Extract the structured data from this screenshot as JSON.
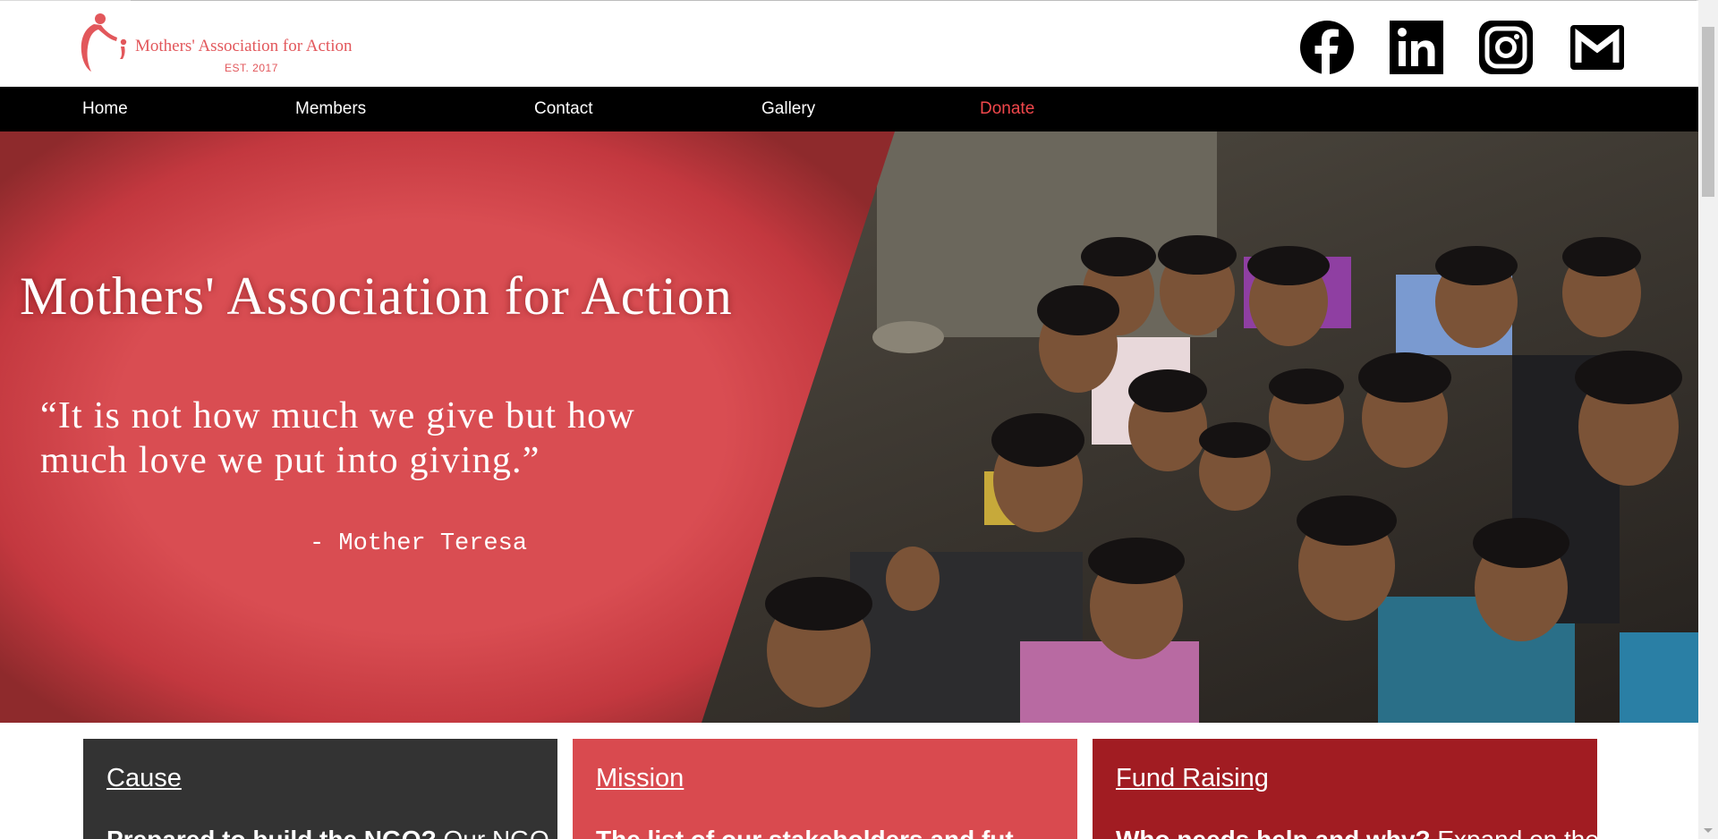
{
  "header": {
    "logo": {
      "title": "Mothers' Association for Action",
      "est": "EST. 2017"
    },
    "social": [
      "facebook-icon",
      "linkedin-icon",
      "instagram-icon",
      "gmail-icon"
    ]
  },
  "nav": {
    "items": [
      {
        "label": "Home"
      },
      {
        "label": "Members"
      },
      {
        "label": "Contact"
      },
      {
        "label": "Gallery"
      },
      {
        "label": "Donate"
      }
    ],
    "donate_color": "#f0474b"
  },
  "hero": {
    "title": "Mothers' Association for Action",
    "quote": "“It is not how much we give but how much love we put into giving.”",
    "author": "- Mother Teresa",
    "panel_color": "#d94d52"
  },
  "cards": [
    {
      "title": "Cause",
      "text_bold": "Prepared to build the NGO?",
      "text_light": " Our NGO",
      "color": "#333333"
    },
    {
      "title": "Mission",
      "text_bold": "The list of our stakeholders and fut",
      "text_light": "",
      "color": "#d94a4f"
    },
    {
      "title": "Fund Raising",
      "text_bold": "Who needs help and why?",
      "text_light": " Expand on the",
      "color": "#a11c22"
    }
  ]
}
